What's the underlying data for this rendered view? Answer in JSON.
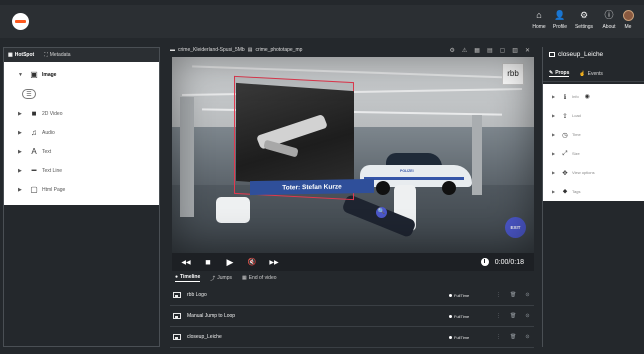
{
  "nav": {
    "items": [
      {
        "label": "Home",
        "icon": "home-icon",
        "glyph": "⌂"
      },
      {
        "label": "Profile",
        "icon": "profile-icon",
        "glyph": "👤"
      },
      {
        "label": "Settings",
        "icon": "settings-icon",
        "glyph": "⚙"
      },
      {
        "label": "About",
        "icon": "about-icon",
        "glyph": "ⓘ"
      },
      {
        "label": "Me",
        "icon": "avatar",
        "glyph": ""
      }
    ]
  },
  "left_panel": {
    "tabs": [
      {
        "label": "HotSpot",
        "icon": "hotspot-icon",
        "glyph": "▦",
        "active": true
      },
      {
        "label": "Metadata",
        "icon": "metadata-icon",
        "glyph": "⛶",
        "active": false
      }
    ],
    "tree": [
      {
        "label": "Image",
        "icon": "image-icon",
        "glyph": "▣",
        "open": true
      },
      {
        "label": "2D Video",
        "icon": "video-icon",
        "glyph": "■"
      },
      {
        "label": "Audio",
        "icon": "audio-icon",
        "glyph": "♫"
      },
      {
        "label": "Text",
        "icon": "text-icon",
        "glyph": "A"
      },
      {
        "label": "Text Line",
        "icon": "text-line-icon",
        "glyph": "━"
      },
      {
        "label": "Html Page",
        "icon": "html-page-icon",
        "glyph": "▢"
      }
    ],
    "sub_chip_glyph": "☰"
  },
  "toolbar": {
    "crumbs": [
      "crime_Kleiderland-Spusi_5Mb",
      "crime_phototape_mp"
    ],
    "tool_glyphs": [
      "⚙",
      "⚠",
      "▦",
      "▤",
      "▢",
      "▥",
      "✕"
    ]
  },
  "video": {
    "hotspot_caption": "Toter: Stefan Kurze",
    "logo_text": "rbb",
    "car_label": "POLIZEI",
    "exit_label": "EXIT",
    "magnifier_glyph": "🔍"
  },
  "controls": {
    "buttons": [
      {
        "name": "rewind-button",
        "glyph": "◀◀"
      },
      {
        "name": "stop-button",
        "glyph": "■"
      },
      {
        "name": "play-button",
        "glyph": "▶"
      },
      {
        "name": "mute-button",
        "glyph": "🔇"
      },
      {
        "name": "forward-button",
        "glyph": "▶▶"
      }
    ],
    "time": "0:00/0:18"
  },
  "bottom_tabs": [
    {
      "label": "Timeline",
      "icon": "timeline-icon",
      "glyph": "●",
      "active": true
    },
    {
      "label": "Jumps",
      "icon": "jumps-icon",
      "glyph": "⤴",
      "active": false
    },
    {
      "label": "End of video",
      "icon": "end-video-icon",
      "glyph": "▦",
      "active": false
    }
  ],
  "timeline": [
    {
      "label": "rbb Logo",
      "mode": "FullTime"
    },
    {
      "label": "Manual Jump to Loop",
      "mode": "FullTime"
    },
    {
      "label": "closeup_Leiche",
      "mode": "FullTime"
    }
  ],
  "row_actions": [
    "⋮",
    "🗑",
    "⊙"
  ],
  "right_panel": {
    "title": "closeup_Leiche",
    "tabs": [
      {
        "label": "Props",
        "icon": "props-icon",
        "glyph": "✎",
        "active": true
      },
      {
        "label": "Events",
        "icon": "events-icon",
        "glyph": "☝",
        "active": false
      }
    ],
    "props": [
      {
        "label": "Info",
        "icon": "info-icon",
        "glyph": "ℹ",
        "eye": true
      },
      {
        "label": "Load",
        "icon": "load-icon",
        "glyph": "⇪"
      },
      {
        "label": "Time",
        "icon": "time-icon",
        "glyph": "◷"
      },
      {
        "label": "Size",
        "icon": "size-icon",
        "glyph": "⤢"
      },
      {
        "label": "View options",
        "icon": "view-options-icon",
        "glyph": "✥"
      },
      {
        "label": "Tags",
        "icon": "tags-icon",
        "glyph": "⬥"
      }
    ]
  },
  "colors": {
    "accent": "#4b57c9",
    "hotspot_border": "#e2394f",
    "caption_bg": "#2f4f9a",
    "brand_orange": "#ff5a1f"
  }
}
